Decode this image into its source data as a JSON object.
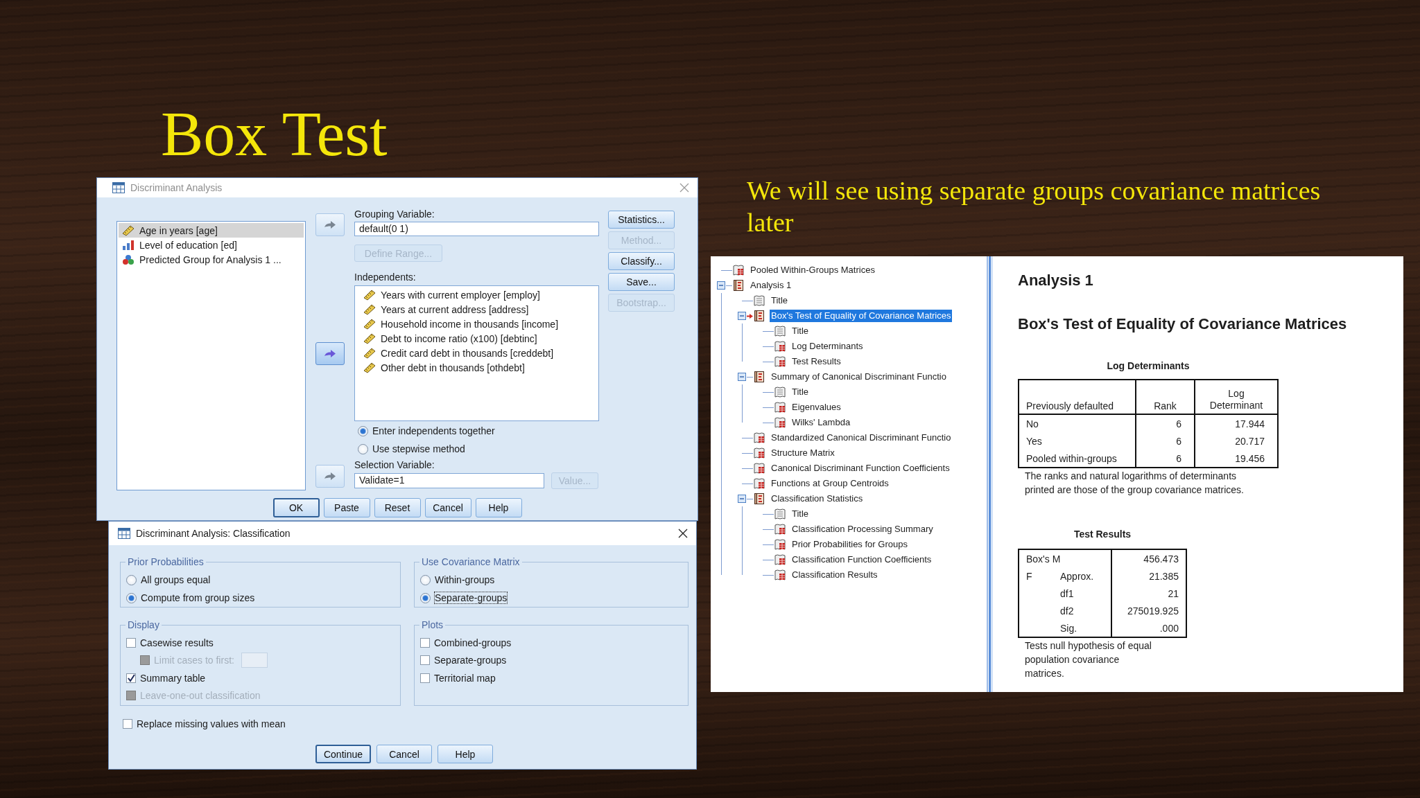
{
  "slide": {
    "title": "Box Test",
    "caption": "We will see using separate groups covariance matrices later"
  },
  "dialog": {
    "title": "Discriminant Analysis",
    "variables": [
      {
        "label": "Age in years [age]",
        "kind": "scale",
        "selected": true
      },
      {
        "label": "Level of education [ed]",
        "kind": "ordinal",
        "selected": false
      },
      {
        "label": "Predicted Group for Analysis 1 ...",
        "kind": "nominal",
        "selected": false
      }
    ],
    "move_buttons": [
      {
        "disabled": true
      },
      {
        "disabled": false
      },
      {
        "disabled": true
      }
    ],
    "grouping": {
      "label": "Grouping Variable:",
      "value": "default(0 1)"
    },
    "define_range": {
      "label": "Define Range...",
      "disabled": true
    },
    "independents": {
      "label": "Independents:",
      "items": [
        {
          "label": "Years with current employer [employ]",
          "kind": "scale"
        },
        {
          "label": "Years at current address [address]",
          "kind": "scale"
        },
        {
          "label": "Household income in thousands [income]",
          "kind": "scale"
        },
        {
          "label": "Debt to income ratio (x100) [debtinc]",
          "kind": "scale"
        },
        {
          "label": "Credit card debt in thousands [creddebt]",
          "kind": "scale"
        },
        {
          "label": "Other debt in thousands [othdebt]",
          "kind": "scale"
        }
      ]
    },
    "methods": [
      {
        "label": "Enter independents together",
        "selected": true
      },
      {
        "label": "Use stepwise method",
        "selected": false
      }
    ],
    "selection": {
      "label": "Selection Variable:",
      "value": "Validate=1"
    },
    "value_button": {
      "label": "Value...",
      "disabled": true
    },
    "side_buttons": [
      {
        "label": "Statistics...",
        "disabled": false
      },
      {
        "label": "Method...",
        "disabled": true
      },
      {
        "label": "Classify...",
        "disabled": false
      },
      {
        "label": "Save...",
        "disabled": false
      },
      {
        "label": "Bootstrap...",
        "disabled": true
      }
    ],
    "buttons": [
      {
        "label": "OK",
        "default": true
      },
      {
        "label": "Paste",
        "default": false
      },
      {
        "label": "Reset",
        "default": false
      },
      {
        "label": "Cancel",
        "default": false
      },
      {
        "label": "Help",
        "default": false
      }
    ]
  },
  "classification": {
    "title": "Discriminant Analysis: Classification",
    "prior": {
      "legend": "Prior Probabilities",
      "options": [
        {
          "label": "All groups equal",
          "selected": false
        },
        {
          "label": "Compute from group sizes",
          "selected": true
        }
      ]
    },
    "covariance": {
      "legend": "Use Covariance Matrix",
      "options": [
        {
          "label": "Within-groups",
          "selected": false,
          "focused": false
        },
        {
          "label": "Separate-groups",
          "selected": true,
          "focused": true
        }
      ]
    },
    "display": {
      "legend": "Display",
      "items": [
        {
          "label": "Casewise results",
          "kind": "checkbox",
          "checked": false,
          "disabled": false
        },
        {
          "label": "Limit cases to first:",
          "kind": "limit",
          "checked": false,
          "disabled": true
        },
        {
          "label": "Summary table",
          "kind": "checkbox",
          "checked": true,
          "disabled": false
        },
        {
          "label": "Leave-one-out classification",
          "kind": "checkbox",
          "checked": false,
          "disabled": true
        }
      ]
    },
    "plots": {
      "legend": "Plots",
      "items": [
        {
          "label": "Combined-groups",
          "kind": "checkbox",
          "checked": false,
          "disabled": false
        },
        {
          "label": "Separate-groups",
          "kind": "checkbox",
          "checked": false,
          "disabled": false
        },
        {
          "label": "Territorial map",
          "kind": "checkbox",
          "checked": false,
          "disabled": false
        }
      ]
    },
    "replace_missing": {
      "label": "Replace missing values with mean",
      "checked": false
    },
    "buttons": [
      {
        "label": "Continue",
        "default": true
      },
      {
        "label": "Cancel",
        "default": false
      },
      {
        "label": "Help",
        "default": false
      }
    ]
  },
  "viewer": {
    "tree": [
      {
        "label": "Pooled Within-Groups Matrices",
        "kind": "table",
        "selected": false
      },
      {
        "label": "Analysis 1",
        "kind": "book",
        "selected": false,
        "expanded": true,
        "children": [
          {
            "label": "Title",
            "kind": "page",
            "selected": false
          },
          {
            "label": "Box's Test of Equality of Covariance Matrices",
            "kind": "book",
            "selected": true,
            "expanded": true,
            "children": [
              {
                "label": "Title",
                "kind": "page",
                "selected": false
              },
              {
                "label": "Log Determinants",
                "kind": "table",
                "selected": false
              },
              {
                "label": "Test Results",
                "kind": "table",
                "selected": false
              }
            ]
          },
          {
            "label": "Summary of Canonical Discriminant Functio",
            "kind": "book",
            "selected": false,
            "expanded": true,
            "children": [
              {
                "label": "Title",
                "kind": "page",
                "selected": false
              },
              {
                "label": "Eigenvalues",
                "kind": "table",
                "selected": false
              },
              {
                "label": "Wilks' Lambda",
                "kind": "table",
                "selected": false
              }
            ]
          },
          {
            "label": "Standardized Canonical Discriminant Functio",
            "kind": "table",
            "selected": false
          },
          {
            "label": "Structure Matrix",
            "kind": "table",
            "selected": false
          },
          {
            "label": "Canonical Discriminant Function Coefficients",
            "kind": "table",
            "selected": false
          },
          {
            "label": "Functions at Group Centroids",
            "kind": "table",
            "selected": false
          },
          {
            "label": "Classification Statistics",
            "kind": "book",
            "selected": false,
            "expanded": true,
            "children": [
              {
                "label": "Title",
                "kind": "page",
                "selected": false
              },
              {
                "label": "Classification Processing Summary",
                "kind": "table",
                "selected": false
              },
              {
                "label": "Prior Probabilities for Groups",
                "kind": "table",
                "selected": false
              },
              {
                "label": "Classification Function Coefficients",
                "kind": "table",
                "selected": false
              },
              {
                "label": "Classification Results",
                "kind": "table",
                "selected": false
              }
            ]
          }
        ]
      }
    ],
    "heading": "Analysis 1",
    "title": "Box's Test of Equality of Covariance Matrices",
    "log_determinants": {
      "caption": "Log Determinants",
      "columns": [
        "Previously defaulted",
        "Rank",
        "Log Determinant"
      ],
      "rows": [
        [
          "No",
          "6",
          "17.944"
        ],
        [
          "Yes",
          "6",
          "20.717"
        ],
        [
          "Pooled within-groups",
          "6",
          "19.456"
        ]
      ],
      "footnote": "The ranks and natural logarithms of determinants printed are those of the group covariance matrices."
    },
    "test_results": {
      "caption": "Test Results",
      "rows": [
        {
          "label": "Box's M",
          "value": "456.473"
        },
        {
          "label": "F",
          "sub": "Approx.",
          "value": "21.385"
        },
        {
          "sub": "df1",
          "value": "21"
        },
        {
          "sub": "df2",
          "value": "275019.925"
        },
        {
          "sub": "Sig.",
          "value": ".000"
        }
      ],
      "footnote": "Tests null hypothesis of equal population covariance matrices."
    }
  }
}
